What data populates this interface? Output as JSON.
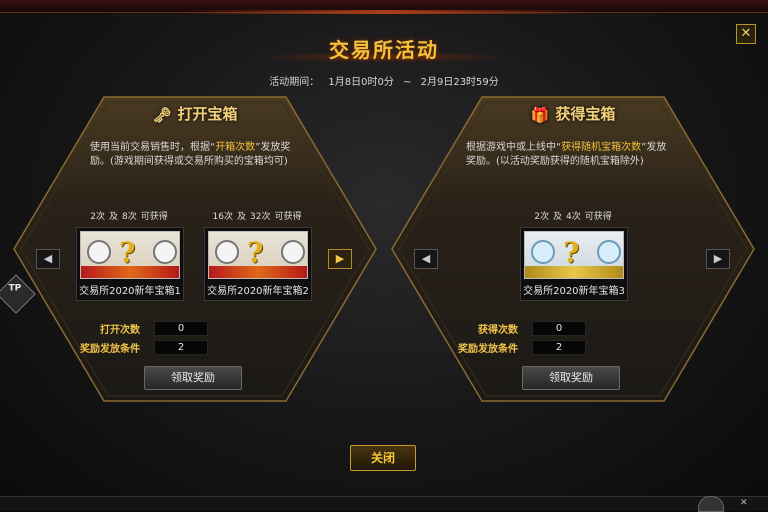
{
  "dialog": {
    "title": "交易所活动",
    "period_label": "活动期间：",
    "period_start": "1月8日0时0分",
    "period_sep": "~",
    "period_end": "2月9日23时59分",
    "close_label": "关闭"
  },
  "left": {
    "title": "打开宝箱",
    "icon": "key-icon",
    "desc_pre": "使用当前交易销售时，根据“",
    "desc_highlight": "开箱次数",
    "desc_post": "”发放奖励。(游戏期间获得或交易所购买的宝箱均可)",
    "items": [
      {
        "cond_a": "2次",
        "cond_and": "及",
        "cond_b": "8次",
        "cond_suffix": "可获得",
        "name": "交易所2020新年宝箱1"
      },
      {
        "cond_a": "16次",
        "cond_and": "及",
        "cond_b": "32次",
        "cond_suffix": "可获得",
        "name": "交易所2020新年宝箱2"
      }
    ],
    "stat1_label": "打开次数",
    "stat1_value": "0",
    "stat2_label": "奖励发放条件",
    "stat2_value": "2",
    "claim_label": "领取奖励"
  },
  "right": {
    "title": "获得宝箱",
    "icon": "gift-icon",
    "desc_pre": "根据游戏中或上线中“",
    "desc_highlight": "获得随机宝箱次数",
    "desc_post": "”发放奖励。(以活动奖励获得的随机宝箱除外)",
    "items": [
      {
        "cond_a": "2次",
        "cond_and": "及",
        "cond_b": "4次",
        "cond_suffix": "可获得",
        "name": "交易所2020新年宝箱3"
      }
    ],
    "stat1_label": "获得次数",
    "stat1_value": "0",
    "stat2_label": "奖励发放条件",
    "stat2_value": "2",
    "claim_label": "领取奖励"
  },
  "side_badge": "TP",
  "colors": {
    "accent": "#f5c23b",
    "highlight": "#f3c13b",
    "border": "#6b5a33"
  }
}
